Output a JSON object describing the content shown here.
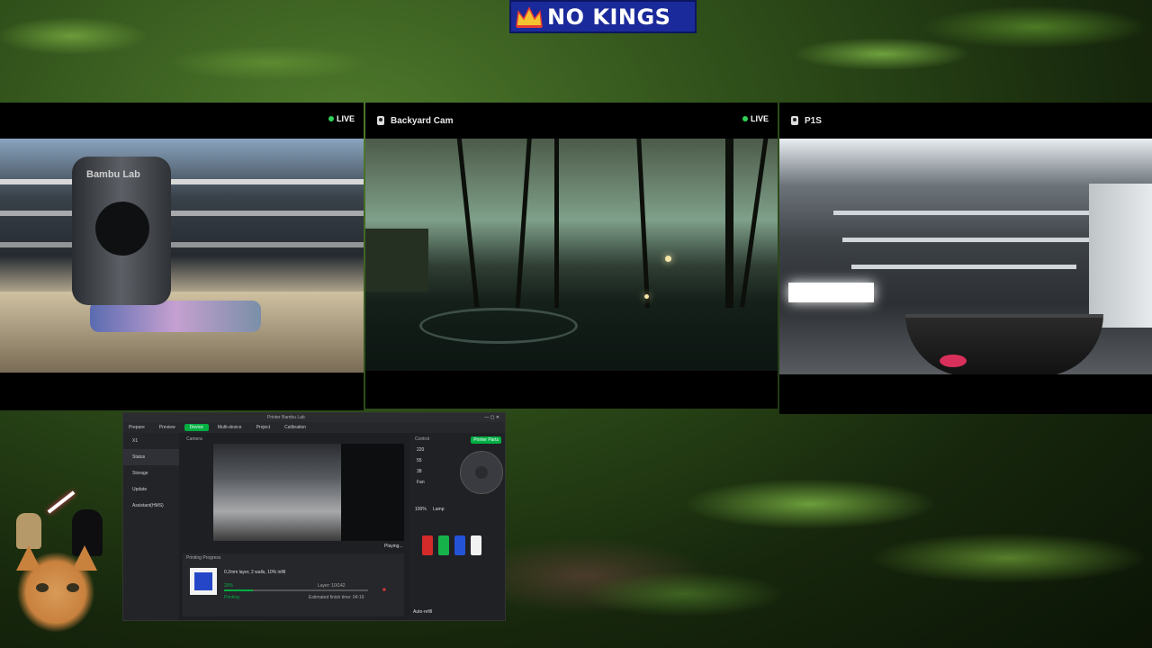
{
  "banner": {
    "text": "NO KINGS",
    "bg_color": "#1b2a9a",
    "icon": "crown-icon"
  },
  "cams": [
    {
      "title": "",
      "live": "LIVE"
    },
    {
      "title": "Backyard Cam",
      "live": "LIVE"
    },
    {
      "title": "P1S",
      "live": ""
    }
  ],
  "feed_overlay": {
    "cam1_brand": "Bambu Lab"
  },
  "slicer": {
    "title": "Printer Bambu Lab",
    "device": "X1",
    "tabs": [
      "Prepare",
      "Preview",
      "Device",
      "Multi-device",
      "Project",
      "Calibration"
    ],
    "active_tab": "Device",
    "sidebar": [
      "Status",
      "Storage",
      "Update",
      "Assistant(HMS)"
    ],
    "camera_label": "Camera",
    "playing": "Playing...",
    "progress_title": "Printing Progress",
    "job_info": "0.2mm layer, 2 walls, 10% infill",
    "percent": "20%",
    "layer": "Layer: 10/142",
    "eta": "Estimated finish time: 04:19",
    "status_word": "Printing",
    "control_label": "Control",
    "printer_parts": "Printer Parts",
    "temps": [
      "220",
      "55",
      "38"
    ],
    "fan_label": "Fan",
    "lamp_label": "Lamp",
    "speed": "100%",
    "auto_refill": "Auto-refill",
    "accent_color": "#00ae42",
    "spool_colors": [
      "#d42a2a",
      "#16b34a",
      "#2453d6",
      "#f2f2f2"
    ]
  },
  "overlay": {
    "character_icon": "kitten-icon",
    "figure_icons": [
      "luke-icon",
      "vader-icon",
      "lightsaber-icon"
    ]
  }
}
